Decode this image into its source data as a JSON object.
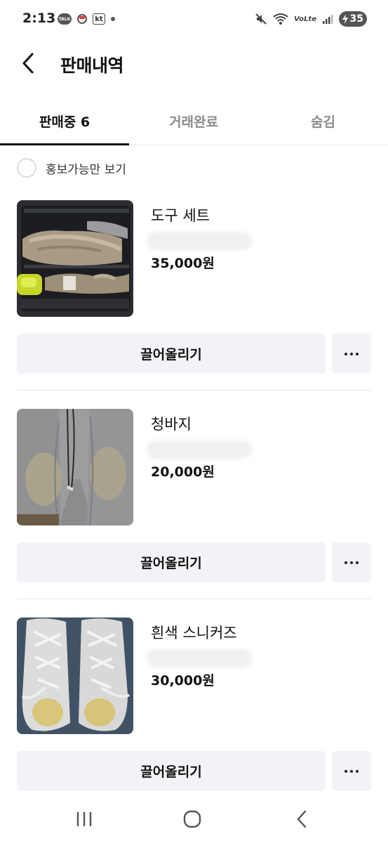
{
  "status_bar": {
    "time": "2:13",
    "talk_badge": "TALK",
    "carrier": "kt",
    "volte": "VoLte",
    "battery": "35",
    "icons": [
      "kakaotalk-icon",
      "notification-icon",
      "kt-carrier-icon",
      "dot-icon",
      "mute-icon",
      "wifi-icon",
      "volte-icon",
      "signal-icon",
      "battery-charging-icon"
    ]
  },
  "header": {
    "title": "판매내역",
    "back_icon": "chevron-left-icon"
  },
  "tabs": [
    {
      "label": "판매중 6",
      "active": true
    },
    {
      "label": "거래완료",
      "active": false
    },
    {
      "label": "숨김",
      "active": false
    }
  ],
  "filter": {
    "label": "홍보가능만 보기",
    "checked": false
  },
  "items": [
    {
      "name": "도구 세트",
      "price": "35,000원",
      "bump_label": "끌어올리기",
      "more_icon": "more-horizontal-icon"
    },
    {
      "name": "청바지",
      "price": "20,000원",
      "bump_label": "끌어올리기",
      "more_icon": "more-horizontal-icon"
    },
    {
      "name": "흰색 스니커즈",
      "price": "30,000원",
      "bump_label": "끌어올리기",
      "more_icon": "more-horizontal-icon"
    }
  ],
  "nav_bar": {
    "icons": [
      "recent-apps-icon",
      "home-icon",
      "back-icon"
    ]
  },
  "colors": {
    "button_bg": "#f2f3f6",
    "divider": "#e6e6e6",
    "inactive_tab": "#8c8c8c",
    "text": "#111111"
  }
}
